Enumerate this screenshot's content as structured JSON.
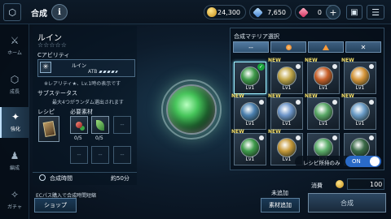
{
  "header": {
    "back_icon": "back-arrow-icon",
    "title": "合成",
    "info_label": "i",
    "currency": {
      "gold": "24,300",
      "crystal": "7,650",
      "gem": "0",
      "gem_plus": "+"
    },
    "gift_icon": "gift-box-icon",
    "menu_icon": "hamburger-menu-icon"
  },
  "sidebar": {
    "items": [
      {
        "label": "ホーム",
        "icon": "home-icon",
        "glyph": "⚔"
      },
      {
        "label": "成長",
        "icon": "growth-icon",
        "glyph": "⬡"
      },
      {
        "label": "強化",
        "icon": "enhance-icon",
        "glyph": "✦",
        "active": true
      },
      {
        "label": "編成",
        "icon": "party-icon",
        "glyph": "♟"
      },
      {
        "label": "ガチャ",
        "icon": "gacha-icon",
        "glyph": "✧"
      }
    ]
  },
  "recipe": {
    "name": "ルイン",
    "stars": "☆☆☆☆☆",
    "ability_header": "Cアビリティ",
    "ability_icon_glyph": "✳",
    "ability_name": "ルイン",
    "ability_atb": "ATB",
    "ability_note": "※レアリティ★、Lv.1時の表示です",
    "sub_header": "サブステータス",
    "sub_note": "最大4つがランダム選出されます",
    "recipe_header": "レシピ",
    "materials_header": "必要素材",
    "materials": [
      {
        "count": "0/5",
        "kind": "red"
      },
      {
        "count": "0/5",
        "kind": "green"
      },
      {
        "empty": "--"
      },
      {
        "empty": "--"
      },
      {
        "empty": "--"
      },
      {
        "empty": "--"
      }
    ],
    "craft_time_label": "合成時間",
    "craft_time_value": "約50分"
  },
  "footer_left": {
    "ecpass_note": "ECパス購入で合成時間短縮",
    "shop_label": "ショップ"
  },
  "materia_panel": {
    "header": "合成マテリア選択",
    "filters": [
      {
        "label": "--",
        "icon": ""
      },
      {
        "label": "",
        "icon": "orange-dot-icon"
      },
      {
        "label": "",
        "icon": "orange-triangle-icon"
      },
      {
        "label": "✕",
        "icon": ""
      }
    ],
    "new_label": "NEW",
    "level_label": "Lv1",
    "grid": [
      {
        "new": false,
        "color": "#3f9a4a",
        "selected": true
      },
      {
        "new": true,
        "color": "#c2a74a"
      },
      {
        "new": true,
        "color": "#c8602a"
      },
      {
        "new": true,
        "color": "#d6963a"
      },
      {
        "new": true,
        "color": "#4a7fae"
      },
      {
        "new": true,
        "color": "#6d95c9"
      },
      {
        "new": true,
        "color": "#5aa866"
      },
      {
        "new": true,
        "color": "#6a9cc7"
      },
      {
        "new": true,
        "color": "#3e9a4b"
      },
      {
        "new": true,
        "color": "#c69a3a"
      },
      {
        "new": false,
        "color": "#5cae6a"
      },
      {
        "new": false,
        "color": "#3a6a48"
      }
    ],
    "toggle_label": "レシピ所持のみ",
    "toggle_state": "ON"
  },
  "footer_right": {
    "not_added": "未追加",
    "add_material_label": "素材追加",
    "consume_label": "消費",
    "consume_value": "100",
    "craft_label": "合成"
  }
}
